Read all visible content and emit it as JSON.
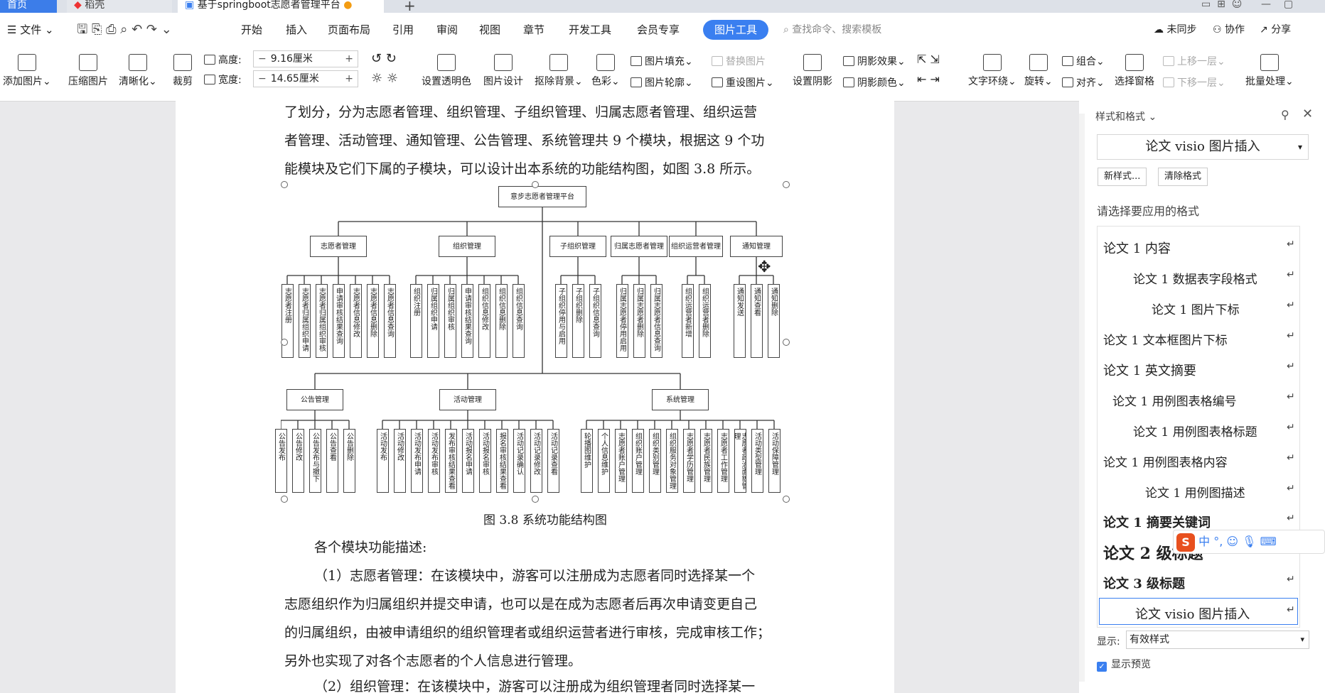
{
  "tabs": {
    "home": "首页",
    "daoke": "稻壳",
    "doc": "基于springboot志愿者管理平台"
  },
  "menu": {
    "file": "文件",
    "items": [
      "开始",
      "插入",
      "页面布局",
      "引用",
      "审阅",
      "视图",
      "章节",
      "开发工具",
      "会员专享"
    ],
    "active": "图片工具",
    "search": "查找命令、搜索模板",
    "unsynced": "未同步",
    "collab": "协作",
    "share": "分享"
  },
  "ribbon": {
    "add_image": "添加图片",
    "compress": "压缩图片",
    "sharpen": "清晰化",
    "crop": "裁剪",
    "height_label": "高度:",
    "height_value": "9.16厘米",
    "width_label": "宽度:",
    "width_value": "14.65厘米",
    "transparent": "设置透明色",
    "design": "图片设计",
    "remove_bg": "抠除背景",
    "color": "色彩",
    "fill": "图片填充",
    "outline": "图片轮廓",
    "replace": "替换图片",
    "reset": "重设图片",
    "set_shadow": "设置阴影",
    "shadow_effect": "阴影效果",
    "shadow_color": "阴影颜色",
    "wrap": "文字环绕",
    "rotate": "旋转",
    "group": "组合",
    "align": "对齐",
    "selection_pane": "选择窗格",
    "bring_forward": "上移一层",
    "send_backward": "下移一层",
    "batch": "批量处理"
  },
  "document": {
    "lines_top": [
      "了划分，分为志愿者管理、组织管理、子组织管理、归属志愿者管理、组织运营",
      "者管理、活动管理、通知管理、公告管理、系统管理共 9 个模块，根据这 9 个功",
      "能模块及它们下属的子模块，可以设计出本系统的功能结构图，如图 3.8 所示。"
    ],
    "caption": "图 3.8  系统功能结构图",
    "heading": "各个模块功能描述:",
    "paragraph1": [
      "（1）志愿者管理：在该模块中，游客可以注册成为志愿者同时选择某一个",
      "志愿组织作为归属组织并提交申请，也可以是在成为志愿者后再次申请变更自己",
      "的归属组织，由被申请组织的组织管理者或组织运营者进行审核，完成审核工作；",
      "另外也实现了对各个志愿者的个人信息进行管理。"
    ],
    "paragraph2_partial": "（2）组织管理：在该模块中，游客可以注册成为组织管理者同时选择某一"
  },
  "diagram": {
    "root": "意步志愿者管理平台",
    "row1": [
      {
        "name": "志愿者管理",
        "leaves": [
          "志愿者注册",
          "志愿者归属组织申请",
          "志愿者归属组织审核",
          "申请审核结果查询",
          "志愿者信息修改",
          "志愿者信息删除",
          "志愿者信息查询"
        ]
      },
      {
        "name": "组织管理",
        "leaves": [
          "组织注册",
          "归属组织申请",
          "归属组织审核",
          "申请审核结果查询",
          "组织信息修改",
          "组织信息删除",
          "组织信息查询"
        ]
      },
      {
        "name": "子组织管理",
        "leaves": [
          "子组织停用与启用",
          "子组织删除",
          "子组织信息查询"
        ]
      },
      {
        "name": "归属志愿者管理",
        "leaves": [
          "归属志愿者停用启用",
          "归属志愿者删除",
          "归属志愿者信息查询"
        ]
      },
      {
        "name": "组织运营者管理",
        "leaves": [
          "组织运营者新增",
          "组织运营者删除"
        ]
      },
      {
        "name": "通知管理",
        "leaves": [
          "通知发送",
          "通知查看",
          "通知删除"
        ]
      }
    ],
    "row2": [
      {
        "name": "公告管理",
        "leaves": [
          "公告发布",
          "公告修改",
          "公告发布与撤下",
          "公告查看",
          "公告删除"
        ]
      },
      {
        "name": "活动管理",
        "leaves": [
          "活动发布",
          "活动修改",
          "活动发布申请",
          "活动发布审核",
          "发布审核结果查看",
          "活动报名申请",
          "活动报名审核",
          "报名审核结果查看",
          "活动记录确认",
          "活动记录修改",
          "活动记录查看"
        ]
      },
      {
        "name": "系统管理",
        "leaves": [
          "轮播图维护",
          "个人信息维护",
          "志愿者账户管理",
          "组织账户管理",
          "组织类别管理",
          "组织服务对象管理",
          "志愿者学历管理",
          "志愿者民族管理",
          "志愿者工作管理",
          "志愿者政治面貌管理",
          "活动类型管理",
          "活动保障管理"
        ]
      }
    ]
  },
  "sidepanel": {
    "title": "样式和格式",
    "current_style": "论文 visio 图片插入",
    "new_style": "新样式...",
    "clear_format": "清除格式",
    "prompt": "请选择要应用的格式",
    "styles": [
      "论文 1 内容",
      "论文 1 数据表字段格式",
      "论文 1 图片下标",
      "论文 1 文本框图片下标",
      "论文 1 英文摘要",
      "论文 1 用例图表格编号",
      "论文 1 用例图表格标题",
      "论文 1 用例图表格内容",
      "论文 1 用例图描述",
      "论文 1 摘要关键词",
      "论文 2 级标题",
      "论文 3 级标题",
      "论文 visio 图片插入"
    ],
    "show_label": "显示:",
    "show_value": "有效样式",
    "preview": "显示预览",
    "return_mark": "↵"
  },
  "ime": {
    "lang": "中",
    "punct": "°,"
  },
  "colors": {
    "accent": "#3a7ff0",
    "home_tab": "#3c7de9"
  }
}
